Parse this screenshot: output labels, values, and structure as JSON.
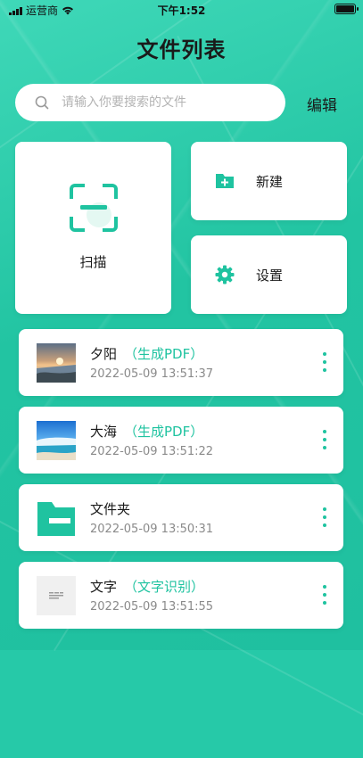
{
  "status_bar": {
    "carrier": "运营商",
    "time": "下午1:52"
  },
  "header": {
    "title": "文件列表",
    "edit_label": "编辑"
  },
  "search": {
    "placeholder": "请输入你要搜索的文件",
    "value": ""
  },
  "actions": {
    "scan_label": "扫描",
    "new_label": "新建",
    "settings_label": "设置"
  },
  "files": [
    {
      "name": "夕阳",
      "tag": "（生成PDF）",
      "time": "2022-05-09 13:51:37",
      "thumb": "sunset-image"
    },
    {
      "name": "大海",
      "tag": "（生成PDF）",
      "time": "2022-05-09 13:51:22",
      "thumb": "sea-image"
    },
    {
      "name": "文件夹",
      "tag": "",
      "time": "2022-05-09 13:50:31",
      "thumb": "folder-icon"
    },
    {
      "name": "文字",
      "tag": "（文字识别）",
      "time": "2022-05-09 13:51:55",
      "thumb": "text-document-image"
    }
  ],
  "colors": {
    "accent": "#1fc3a0",
    "background": "#26c9a8"
  }
}
